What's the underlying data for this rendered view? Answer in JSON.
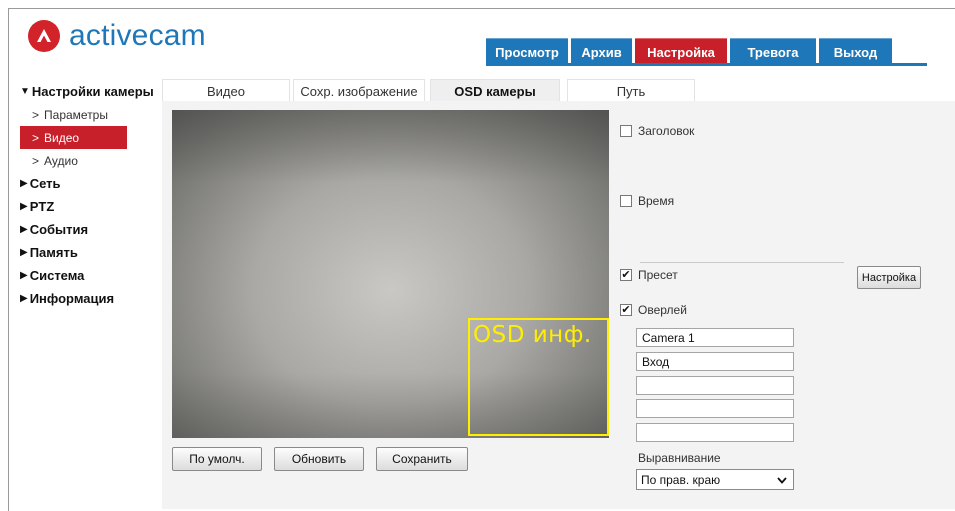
{
  "brand": {
    "name": "activecam",
    "color": "#1e77b8",
    "mark_color": "#d2222a"
  },
  "topnav": [
    {
      "label": "Просмотр",
      "active": false
    },
    {
      "label": "Архив",
      "active": false
    },
    {
      "label": "Настройка",
      "active": true
    },
    {
      "label": "Тревога",
      "active": false
    },
    {
      "label": "Выход",
      "active": false
    }
  ],
  "sidebar": {
    "camera_settings": "Настройки камеры",
    "sub": [
      "Параметры",
      "Видео",
      "Аудио"
    ],
    "groups": [
      "Сеть",
      "PTZ",
      "События",
      "Память",
      "Система",
      "Информация"
    ]
  },
  "subtabs": [
    {
      "label": "Видео",
      "active": false
    },
    {
      "label": "Сохр. изображение",
      "active": false
    },
    {
      "label": "OSD камеры",
      "active": true
    },
    {
      "label": "Путь",
      "active": false
    }
  ],
  "video": {
    "osd_text": "OSD инф.",
    "osd_color": "#ffee00"
  },
  "buttons": {
    "default": "По умолч.",
    "refresh": "Обновить",
    "save": "Сохранить",
    "setup": "Настройка"
  },
  "options": {
    "title": {
      "label": "Заголовок",
      "checked": false
    },
    "time": {
      "label": "Время",
      "checked": false
    },
    "preset": {
      "label": "Пресет",
      "checked": true
    },
    "overlay": {
      "label": "Оверлей",
      "checked": true
    }
  },
  "overlay_lines": [
    "Camera 1",
    "Вход",
    "",
    "",
    ""
  ],
  "alignment": {
    "label": "Выравнивание",
    "value": "По прав. краю"
  }
}
